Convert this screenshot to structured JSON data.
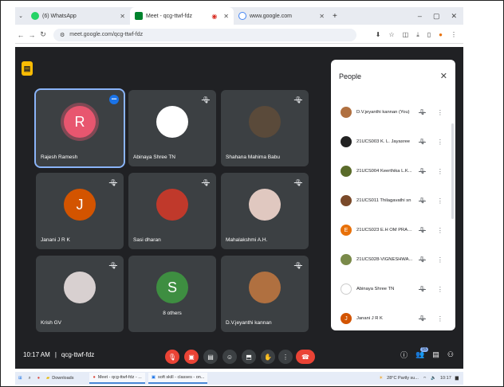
{
  "browser": {
    "tabs": [
      {
        "label": "(6) WhatsApp",
        "color": "#25d366"
      },
      {
        "label": "Meet - qcg-ttwf-fdz",
        "color": "#00832d"
      },
      {
        "label": "www.google.com",
        "color": "#4285f4"
      }
    ],
    "address": "meet.google.com/qcg-ttwf-fdz"
  },
  "meeting": {
    "time": "10:17 AM",
    "separator": "|",
    "code": "qcg-ttwf-fdz",
    "tiles": [
      {
        "name": "Rajesh Ramesh",
        "initial": "R",
        "avatar_color": "#e8566f",
        "speaking": true
      },
      {
        "name": "Abinaya Shree TN",
        "initial": "",
        "avatar_color": "#ffffff",
        "speaking": false
      },
      {
        "name": "Shahana Mahima Babu",
        "initial": "",
        "avatar_color": "#5a4a3a",
        "speaking": false
      },
      {
        "name": "Janani J R K",
        "initial": "J",
        "avatar_color": "#d35400",
        "speaking": false
      },
      {
        "name": "Sasi dharan",
        "initial": "",
        "avatar_color": "#c0392b",
        "speaking": false
      },
      {
        "name": "Mahalakshmi A.H.",
        "initial": "",
        "avatar_color": "#e0c8c0",
        "speaking": false
      },
      {
        "name": "Krish GV",
        "initial": "",
        "avatar_color": "#d8d0d0",
        "speaking": false
      },
      {
        "name": "8 others",
        "initial": "S",
        "avatar_color": "#3e8e41",
        "speaking": false
      },
      {
        "name": "D.V.jeyanthi kannan",
        "initial": "",
        "avatar_color": "#b07040",
        "speaking": false
      }
    ],
    "participant_count": "15"
  },
  "people_panel": {
    "title": "People",
    "list": [
      {
        "name": "D.V.jeyanthi kannan (You)",
        "initial": "",
        "color": "#b07040"
      },
      {
        "name": "21UCS003 K. L. Jayasree",
        "initial": "",
        "color": "#222222"
      },
      {
        "name": "21UCS004 Keerthika L.K...",
        "initial": "",
        "color": "#5a6b2a"
      },
      {
        "name": "21UCS011 Thilagavathi sn",
        "initial": "",
        "color": "#7a4a2a"
      },
      {
        "name": "21UCS023 E.H OM PRAK...",
        "initial": "E",
        "color": "#e8710a"
      },
      {
        "name": "21UCS028-VIGNESHWA...",
        "initial": "",
        "color": "#7a8a4a"
      },
      {
        "name": "Abinaya Shree TN",
        "initial": "",
        "color": "#ffffff"
      },
      {
        "name": "Janani J R K",
        "initial": "J",
        "color": "#d35400"
      }
    ]
  },
  "taskbar": {
    "downloads": "Downloads",
    "meet_app": "Meet - qcg-ttwf-fdz - ...",
    "skill_app": "soft skill - classes - on...",
    "weather": "28°C Partly su...",
    "clock": "10:17"
  },
  "colors": {
    "accent": "#8ab4f8",
    "danger": "#ea4335",
    "bg": "#202124",
    "tile": "#3c4043"
  }
}
